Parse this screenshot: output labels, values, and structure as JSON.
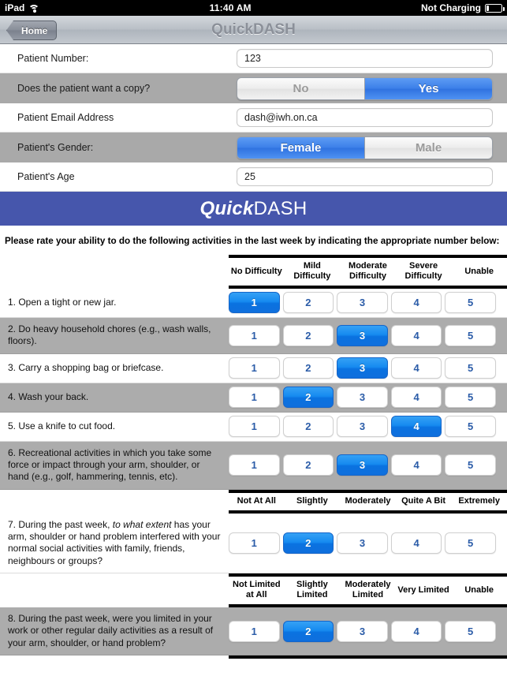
{
  "statusbar": {
    "device": "iPad",
    "wifi_icon": "wifi-icon",
    "time": "11:40 AM",
    "battery_text": "Not Charging",
    "battery_icon": "battery-icon"
  },
  "navbar": {
    "back_label": "Home",
    "title": "QuickDASH"
  },
  "demographics": [
    {
      "label": "Patient Number:",
      "type": "text",
      "value": "123",
      "placeholder": ""
    },
    {
      "label": "Does the patient want a copy?",
      "type": "segmented",
      "options": [
        "No",
        "Yes"
      ],
      "selected": "Yes"
    },
    {
      "label": "Patient Email Address",
      "type": "text",
      "value": "dash@iwh.on.ca",
      "placeholder": ""
    },
    {
      "label": "Patient's Gender:",
      "type": "segmented",
      "options": [
        "Female",
        "Male"
      ],
      "selected": "Female"
    },
    {
      "label": "Patient's Age",
      "type": "text",
      "value": "25",
      "placeholder": ""
    }
  ],
  "banner": {
    "italic_part": "Quick",
    "bold_part": "DASH",
    "color": "#4656ac"
  },
  "instruction": "Please rate your ability to do the following activities in the last week by indicating the appropriate number below:",
  "scales": {
    "difficulty": [
      "No Difficulty",
      "Mild Difficulty",
      "Moderate Difficulty",
      "Severe Difficulty",
      "Unable"
    ],
    "extent": [
      "Not At All",
      "Slightly",
      "Moderately",
      "Quite A Bit",
      "Extremely"
    ],
    "limited": [
      "Not Limited at All",
      "Slightly Limited",
      "Moderately Limited",
      "Very Limited",
      "Unable"
    ]
  },
  "option_values": [
    "1",
    "2",
    "3",
    "4",
    "5"
  ],
  "questions_difficulty": [
    {
      "text": "1. Open a tight or new jar.",
      "selected": 1
    },
    {
      "text": "2. Do heavy household chores (e.g., wash walls, floors).",
      "selected": 3
    },
    {
      "text": "3. Carry a shopping bag or briefcase.",
      "selected": 3
    },
    {
      "text": "4. Wash your back.",
      "selected": 2
    },
    {
      "text": "5. Use a knife to cut food.",
      "selected": 4
    },
    {
      "text": "6. Recreational activities in which you take some force or impact through your arm, shoulder, or hand (e.g.,  golf, hammering, tennis, etc).",
      "selected": 3
    }
  ],
  "question7": {
    "text_start": "7.  During the past week, ",
    "text_italic": "to what extent",
    "text_end": " has your arm, shoulder or hand problem interfered with your normal social activities with family, friends, neighbours or groups?",
    "selected": 2
  },
  "question8": {
    "text": "8.  During the past week, were you limited in your work or other regular daily activities as a result of your arm, shoulder, or hand problem?",
    "selected": 2
  },
  "accent_color": "#0a72e0",
  "row_alt_color": "#acacac"
}
